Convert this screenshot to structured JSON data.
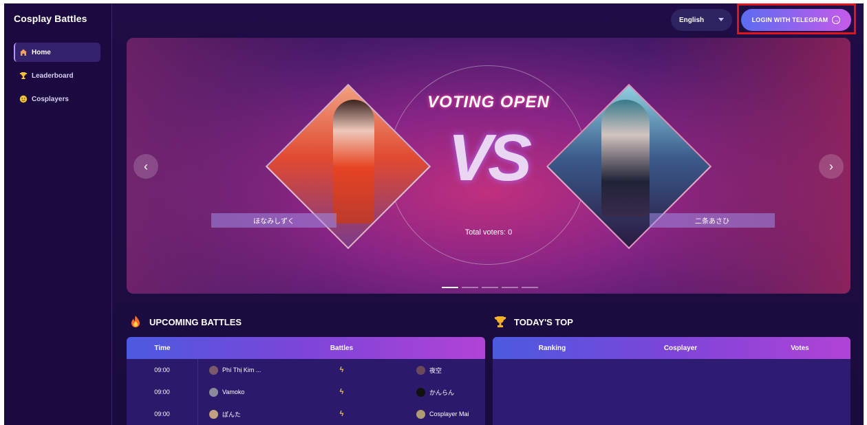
{
  "app": {
    "title": "Cosplay Battles"
  },
  "sidebar": {
    "items": [
      {
        "label": "Home",
        "icon": "home-icon",
        "active": true
      },
      {
        "label": "Leaderboard",
        "icon": "trophy-icon",
        "active": false
      },
      {
        "label": "Cosplayers",
        "icon": "cosplayer-face-icon",
        "active": false
      }
    ]
  },
  "topbar": {
    "language": "English",
    "login_label": "LOGIN WITH TELEGRAM"
  },
  "banner": {
    "headline": "VOTING OPEN",
    "vs": "VS",
    "left_name": "ほなみしずく",
    "right_name": "二条あさひ",
    "total_voters": "Total voters: 0",
    "slide_count": 5,
    "active_slide": 1
  },
  "upcoming": {
    "title": "UPCOMING BATTLES",
    "columns": [
      "Time",
      "Battles"
    ],
    "rows": [
      {
        "time": "09:00",
        "a": "Phí Thị Kim ...",
        "b": "夜空"
      },
      {
        "time": "09:00",
        "a": "Vamoko",
        "b": "かんらん"
      },
      {
        "time": "09:00",
        "a": "ぽんた",
        "b": "Cosplayer Mai"
      }
    ]
  },
  "today_top": {
    "title": "TODAY'S TOP",
    "columns": [
      "Ranking",
      "Cosplayer",
      "Votes"
    ]
  },
  "colors": {
    "accent_start": "#5c6cf0",
    "accent_end": "#c65ae9",
    "highlight_frame": "#e0141e",
    "background": "#1a0b3b"
  }
}
